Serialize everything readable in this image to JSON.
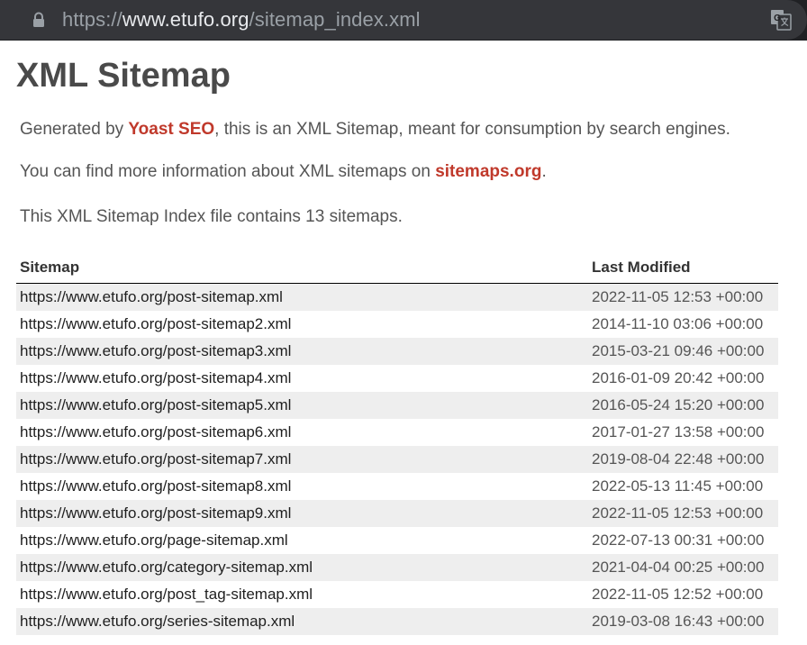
{
  "browser": {
    "url_scheme": "https://",
    "url_host": "www.etufo.org",
    "url_path": "/sitemap_index.xml"
  },
  "page": {
    "title": "XML Sitemap",
    "intro1_before": "Generated by ",
    "intro1_link": "Yoast SEO",
    "intro1_after": ", this is an XML Sitemap, meant for consumption by search engines.",
    "intro2_before": "You can find more information about XML sitemaps on ",
    "intro2_link": "sitemaps.org",
    "intro2_after": ".",
    "count_text": "This XML Sitemap Index file contains 13 sitemaps."
  },
  "table": {
    "headers": [
      "Sitemap",
      "Last Modified"
    ],
    "rows": [
      {
        "loc": "https://www.etufo.org/post-sitemap.xml",
        "lastmod": "2022-11-05 12:53 +00:00"
      },
      {
        "loc": "https://www.etufo.org/post-sitemap2.xml",
        "lastmod": "2014-11-10 03:06 +00:00"
      },
      {
        "loc": "https://www.etufo.org/post-sitemap3.xml",
        "lastmod": "2015-03-21 09:46 +00:00"
      },
      {
        "loc": "https://www.etufo.org/post-sitemap4.xml",
        "lastmod": "2016-01-09 20:42 +00:00"
      },
      {
        "loc": "https://www.etufo.org/post-sitemap5.xml",
        "lastmod": "2016-05-24 15:20 +00:00"
      },
      {
        "loc": "https://www.etufo.org/post-sitemap6.xml",
        "lastmod": "2017-01-27 13:58 +00:00"
      },
      {
        "loc": "https://www.etufo.org/post-sitemap7.xml",
        "lastmod": "2019-08-04 22:48 +00:00"
      },
      {
        "loc": "https://www.etufo.org/post-sitemap8.xml",
        "lastmod": "2022-05-13 11:45 +00:00"
      },
      {
        "loc": "https://www.etufo.org/post-sitemap9.xml",
        "lastmod": "2022-11-05 12:53 +00:00"
      },
      {
        "loc": "https://www.etufo.org/page-sitemap.xml",
        "lastmod": "2022-07-13 00:31 +00:00"
      },
      {
        "loc": "https://www.etufo.org/category-sitemap.xml",
        "lastmod": "2021-04-04 00:25 +00:00"
      },
      {
        "loc": "https://www.etufo.org/post_tag-sitemap.xml",
        "lastmod": "2022-11-05 12:52 +00:00"
      },
      {
        "loc": "https://www.etufo.org/series-sitemap.xml",
        "lastmod": "2019-03-08 16:43 +00:00"
      }
    ]
  },
  "icons": {
    "lock": "lock-icon",
    "translate": "translate-icon"
  },
  "colors": {
    "link_accent": "#c0392b",
    "address_bar": "#35363a",
    "row_stripe": "#eeeeee"
  }
}
